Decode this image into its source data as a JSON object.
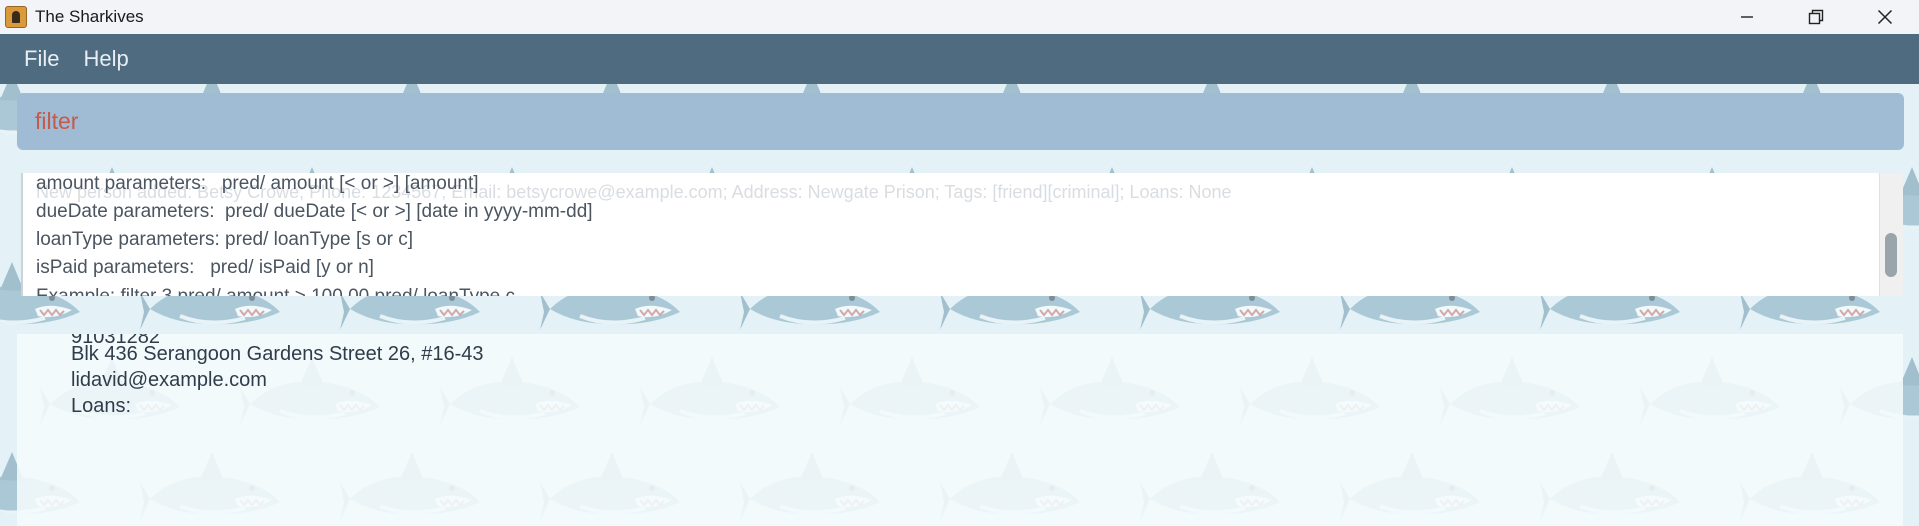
{
  "window": {
    "title": "The Sharkives"
  },
  "menu": {
    "items": [
      "File",
      "Help"
    ]
  },
  "command": {
    "value": "filter"
  },
  "result": {
    "ghost_text": "New person added: Betsy Crowe; Phone: 1234567; Email: betsycrowe@example.com; Address: Newgate Prison; Tags: [friend][criminal]; Loans: None",
    "lines": [
      "amount parameters:   pred/ amount [< or >] [amount]",
      "dueDate parameters:  pred/ dueDate [< or >] [date in yyyy-mm-dd]",
      "loanType parameters: pred/ loanType [s or c]",
      "isPaid parameters:   pred/ isPaid [y or n]",
      "Example: filter 3 pred/ amount > 100.00 pred/ loanType c"
    ]
  },
  "person": {
    "phone": "91031282",
    "address": "Blk 436 Serangoon Gardens Street 26, #16-43",
    "email": "lidavid@example.com",
    "loans_label": "Loans:"
  },
  "colors": {
    "menubar": "#4f6b80",
    "command_box": "#a0bcd4",
    "command_text": "#c45a4a",
    "background": "#e4f2f7"
  }
}
